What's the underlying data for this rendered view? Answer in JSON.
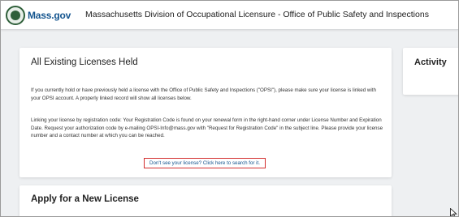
{
  "header": {
    "brand": "Mass.gov",
    "agency_title": "Massachusetts Division of Occupational Licensure - Office of Public Safety and Inspections"
  },
  "licenses_card": {
    "title": "All Existing Licenses Held",
    "paragraph1": "If you currently hold or have previously held a license with the Office of Public Safety and Inspections (\"OPSI\"), please make sure your license is linked with your OPSI account. A properly linked record will show all licenses below.",
    "paragraph2": "Linking your license by registration code: Your Registration Code is found on your renewal form in the right-hand corner under License Number and Expiration Date. Request your authorization code by e-mailing OPSI-Info@mass.gov with \"Request for Registration Code\" in the subject line. Please provide your license number and a contact number at which you can be reached.",
    "search_link": "Don't see your license? Click here to search for it."
  },
  "activity_card": {
    "title": "Activity"
  },
  "apply_card": {
    "title": "Apply for a New License"
  },
  "colors": {
    "brand_blue": "#14558f",
    "highlight_red": "#d32f2f",
    "seal_green": "#2f5f3a"
  },
  "icons": {
    "logo": "massachusetts-seal-icon",
    "cursor": "mouse-pointer-icon"
  }
}
